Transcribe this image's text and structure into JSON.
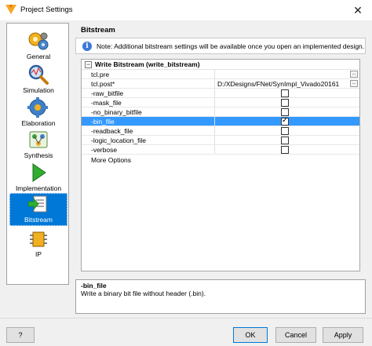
{
  "window": {
    "title": "Project Settings",
    "close_glyph": "✕"
  },
  "sidebar": {
    "items": [
      {
        "label": "General",
        "icon": "gears-icon"
      },
      {
        "label": "Simulation",
        "icon": "magnifier-icon"
      },
      {
        "label": "Elaboration",
        "icon": "gear-icon"
      },
      {
        "label": "Synthesis",
        "icon": "synthesis-icon"
      },
      {
        "label": "Implementation",
        "icon": "play-icon"
      },
      {
        "label": "Bitstream",
        "icon": "bitstream-icon",
        "selected": true
      },
      {
        "label": "IP",
        "icon": "ip-chip-icon"
      }
    ]
  },
  "main": {
    "section_title": "Bitstream",
    "note": "Note: Additional bitstream settings will be available once you open an implemented design.",
    "group": {
      "expand_glyph": "−",
      "label": "Write Bitstream (write_bitstream)"
    },
    "rows": [
      {
        "name": "tcl.pre",
        "value": ""
      },
      {
        "name": "tcl.post*",
        "value": "D:/XDesigns/FNet/SynImpl_Vivado20161/A..."
      },
      {
        "name": "-raw_bitfile",
        "checked": false
      },
      {
        "name": "-mask_file",
        "checked": false
      },
      {
        "name": "-no_binary_bitfile",
        "checked": false
      },
      {
        "name": "-bin_file",
        "checked": true,
        "selected": true
      },
      {
        "name": "-readback_file",
        "checked": false
      },
      {
        "name": "-logic_location_file",
        "checked": false
      },
      {
        "name": "-verbose",
        "checked": false
      }
    ],
    "more_options": "More Options",
    "ellipsis": "..."
  },
  "description": {
    "title": "-bin_file",
    "text": "Write a binary bit file without header (.bin)."
  },
  "buttons": {
    "help": "?",
    "ok": "OK",
    "cancel": "Cancel",
    "apply": "Apply"
  },
  "colors": {
    "selection": "#3399ff",
    "sidebar_selected": "#0078d7",
    "info": "#3c78d8"
  }
}
